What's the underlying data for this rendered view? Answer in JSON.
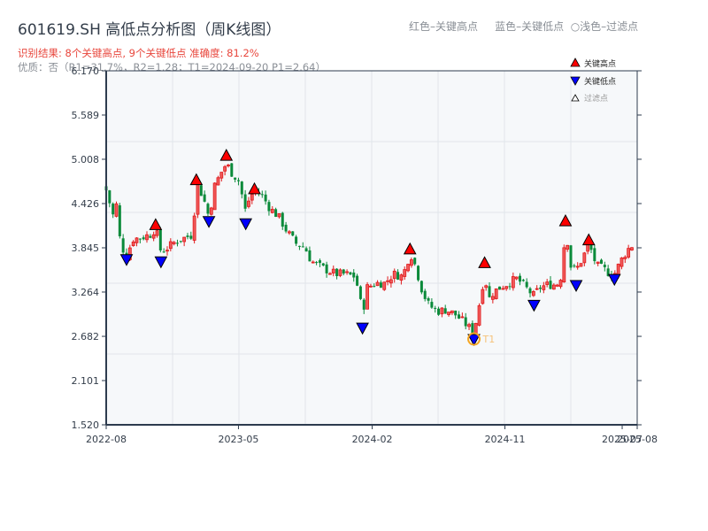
{
  "header": {
    "title": "601619.SH 高低点分析图（周K线图）",
    "result": "识别结果: 8个关键高点, 9个关键低点   准确度: 81.2%",
    "quality": "优质：否（R1=31.7%，R2=1.28；T1=2024-09-20 P1=2.64）",
    "color_hint": "红色–关键高点     蓝色–关键低点  ○浅色–过滤点"
  },
  "chart_data": {
    "type": "candlestick",
    "title": "601619.SH 高低点分析图（周K线图）",
    "ylim": [
      1.52,
      6.17
    ],
    "yticks": [
      "1.520",
      "2.101",
      "2.682",
      "3.264",
      "3.845",
      "4.426",
      "5.008",
      "5.589",
      "6.170"
    ],
    "xticks": [
      {
        "date": "2022-08-01",
        "label": "2022-08"
      },
      {
        "date": "2023-05-01",
        "label": "2023-05"
      },
      {
        "date": "2024-02-01",
        "label": "2024-02"
      },
      {
        "date": "2024-11-01",
        "label": "2024-11"
      },
      {
        "date": "2025-07-01",
        "label": "2025-07"
      },
      {
        "date": "2025-08-01",
        "label": "2025-08"
      }
    ],
    "grid": true,
    "colors": {
      "up": "#e0191b",
      "down": "#0a8a3a",
      "high_marker": "#ff0000",
      "low_marker": "#0000ff",
      "t1_ring": "#f5a623"
    },
    "legend": {
      "position": "top-right",
      "items": [
        {
          "label": "关键高点",
          "marker": "triangle-up",
          "color": "#ff0000"
        },
        {
          "label": "关键低点",
          "marker": "triangle-down",
          "color": "#0000ff"
        },
        {
          "label": "过滤点",
          "marker": "triangle-up-hollow",
          "color": "#ffffff"
        }
      ]
    },
    "close_series": [
      [
        "2022-08-01",
        4.6
      ],
      [
        "2022-08-16",
        4.25
      ],
      [
        "2022-08-23",
        4.43
      ],
      [
        "2022-08-30",
        3.9
      ],
      [
        "2022-09-12",
        3.73
      ],
      [
        "2022-09-25",
        3.96
      ],
      [
        "2022-10-13",
        3.98
      ],
      [
        "2022-10-31",
        4.02
      ],
      [
        "2022-11-11",
        4.1
      ],
      [
        "2022-11-22",
        3.79
      ],
      [
        "2022-12-07",
        3.85
      ],
      [
        "2022-12-25",
        3.94
      ],
      [
        "2023-01-12",
        3.98
      ],
      [
        "2023-01-27",
        4.02
      ],
      [
        "2023-02-03",
        4.72
      ],
      [
        "2023-02-18",
        4.49
      ],
      [
        "2023-03-01",
        4.25
      ],
      [
        "2023-03-13",
        4.66
      ],
      [
        "2023-03-26",
        4.83
      ],
      [
        "2023-04-06",
        4.95
      ],
      [
        "2023-04-17",
        4.83
      ],
      [
        "2023-05-02",
        4.72
      ],
      [
        "2023-05-16",
        4.31
      ],
      [
        "2023-05-23",
        4.49
      ],
      [
        "2023-06-03",
        4.6
      ],
      [
        "2023-06-18",
        4.54
      ],
      [
        "2023-07-04",
        4.37
      ],
      [
        "2023-07-23",
        4.25
      ],
      [
        "2023-08-10",
        4.05
      ],
      [
        "2023-08-28",
        3.9
      ],
      [
        "2023-09-15",
        3.85
      ],
      [
        "2023-09-28",
        3.67
      ],
      [
        "2023-10-13",
        3.61
      ],
      [
        "2023-10-31",
        3.55
      ],
      [
        "2023-11-18",
        3.5
      ],
      [
        "2023-12-06",
        3.5
      ],
      [
        "2023-12-25",
        3.47
      ],
      [
        "2024-01-03",
        3.32
      ],
      [
        "2024-01-12",
        2.97
      ],
      [
        "2024-01-21",
        3.32
      ],
      [
        "2024-02-08",
        3.38
      ],
      [
        "2024-02-27",
        3.38
      ],
      [
        "2024-03-16",
        3.5
      ],
      [
        "2024-04-03",
        3.47
      ],
      [
        "2024-04-12",
        3.61
      ],
      [
        "2024-04-19",
        3.79
      ],
      [
        "2024-04-30",
        3.61
      ],
      [
        "2024-05-15",
        3.26
      ],
      [
        "2024-05-28",
        3.09
      ],
      [
        "2024-06-15",
        3.01
      ],
      [
        "2024-07-03",
        3.03
      ],
      [
        "2024-07-21",
        2.97
      ],
      [
        "2024-08-09",
        2.86
      ],
      [
        "2024-08-21",
        2.78
      ],
      [
        "2024-08-29",
        2.74
      ],
      [
        "2024-09-05",
        2.97
      ],
      [
        "2024-09-14",
        3.26
      ],
      [
        "2024-09-20",
        3.55
      ],
      [
        "2024-09-27",
        3.15
      ],
      [
        "2024-10-08",
        3.26
      ],
      [
        "2024-10-21",
        3.32
      ],
      [
        "2024-11-08",
        3.38
      ],
      [
        "2024-11-26",
        3.44
      ],
      [
        "2024-12-14",
        3.32
      ],
      [
        "2024-12-31",
        3.21
      ],
      [
        "2025-01-11",
        3.32
      ],
      [
        "2025-01-29",
        3.36
      ],
      [
        "2025-02-16",
        3.36
      ],
      [
        "2025-02-27",
        3.5
      ],
      [
        "2025-03-06",
        4.14
      ],
      [
        "2025-03-16",
        3.61
      ],
      [
        "2025-03-28",
        3.55
      ],
      [
        "2025-04-12",
        3.73
      ],
      [
        "2025-04-23",
        3.9
      ],
      [
        "2025-05-09",
        3.61
      ],
      [
        "2025-05-28",
        3.55
      ],
      [
        "2025-06-06",
        3.5
      ],
      [
        "2025-06-15",
        3.5
      ],
      [
        "2025-07-03",
        3.73
      ],
      [
        "2025-07-16",
        3.85
      ],
      [
        "2025-07-27",
        3.9
      ]
    ],
    "key_highs": [
      [
        "2022-11-11",
        4.05
      ],
      [
        "2023-02-03",
        4.64
      ],
      [
        "2023-04-06",
        4.96
      ],
      [
        "2023-06-03",
        4.52
      ],
      [
        "2024-04-19",
        3.73
      ],
      [
        "2024-09-20",
        3.55
      ],
      [
        "2025-03-06",
        4.1
      ],
      [
        "2025-04-23",
        3.85
      ]
    ],
    "key_lows": [
      [
        "2022-09-12",
        3.79
      ],
      [
        "2022-11-22",
        3.76
      ],
      [
        "2023-03-01",
        4.29
      ],
      [
        "2023-05-16",
        4.26
      ],
      [
        "2024-01-12",
        2.89
      ],
      [
        "2024-08-29",
        2.74
      ],
      [
        "2024-12-31",
        3.19
      ],
      [
        "2025-03-28",
        3.45
      ],
      [
        "2025-06-15",
        3.53
      ]
    ],
    "annotation": {
      "label": "T1",
      "date": "2024-08-29",
      "price": 2.74
    }
  }
}
